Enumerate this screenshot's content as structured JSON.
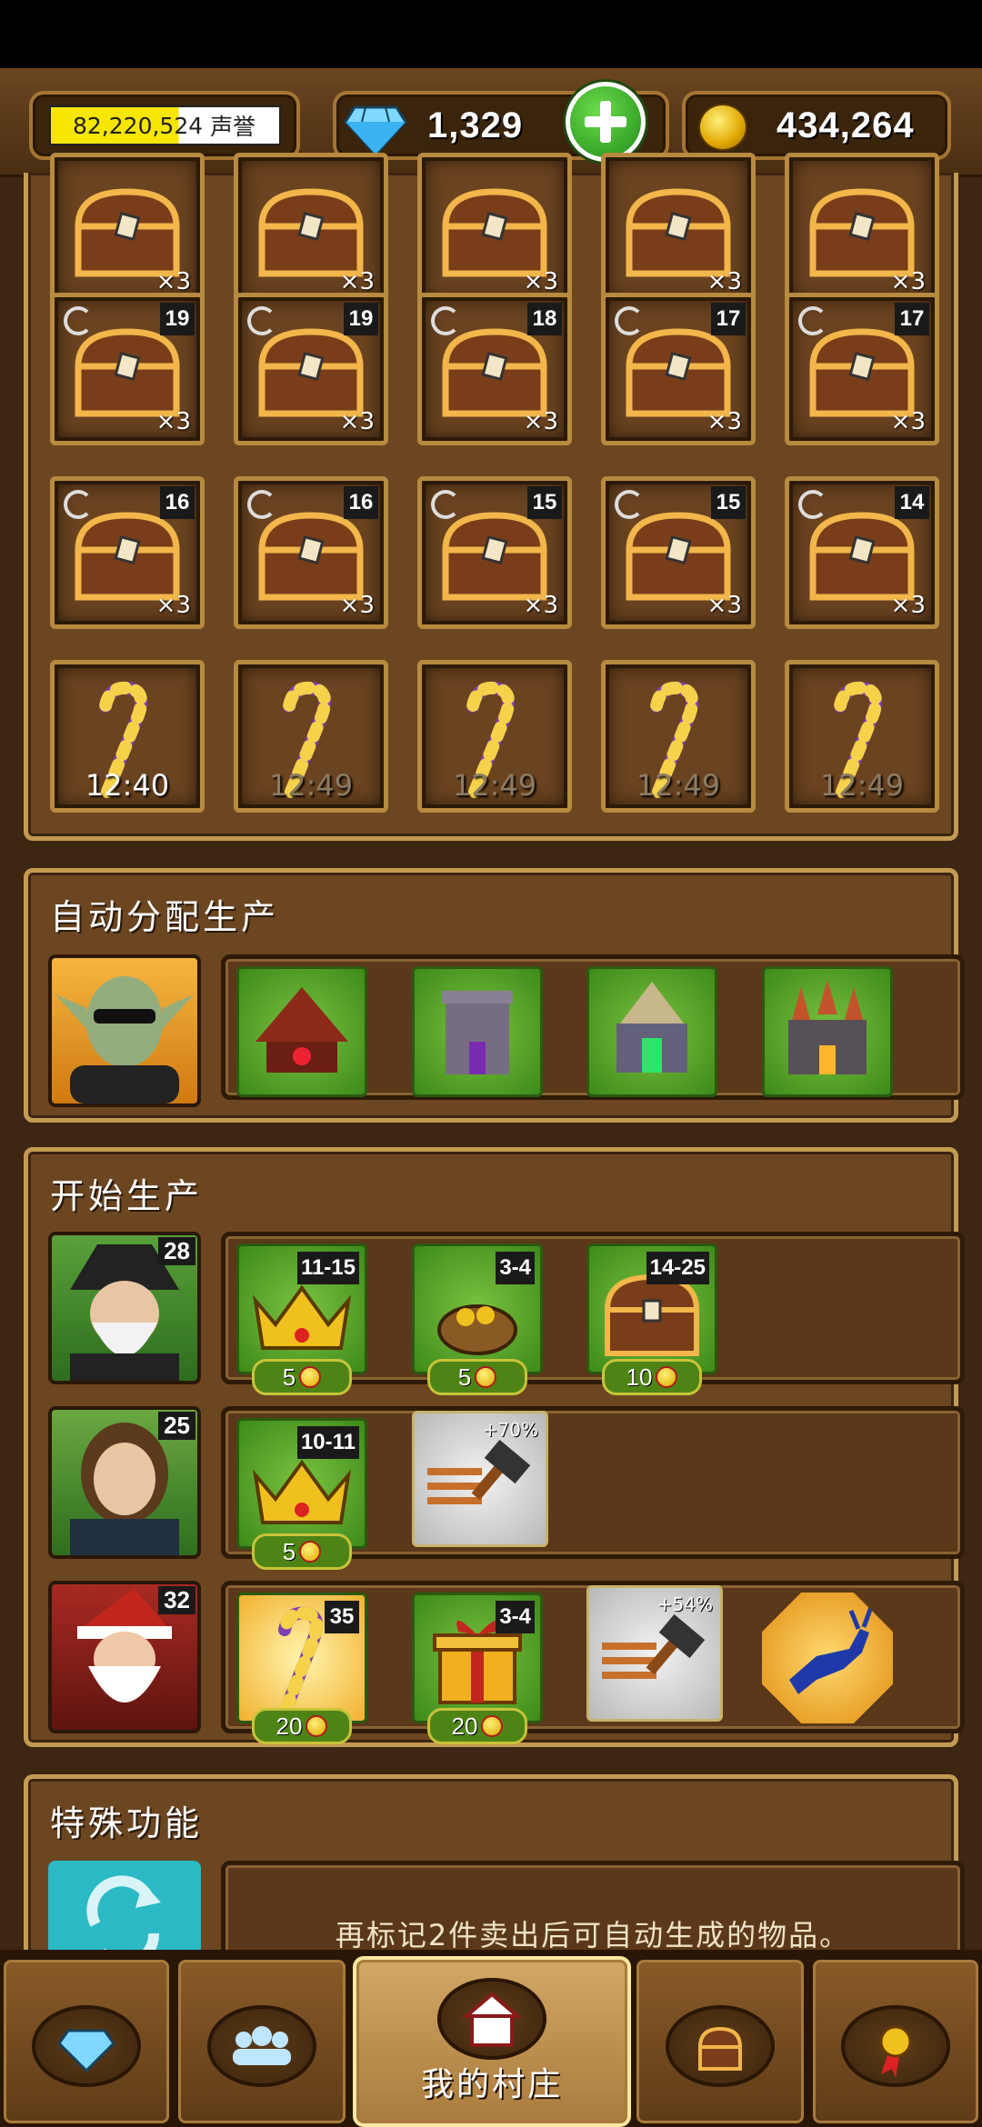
{
  "topbar": {
    "fame_value": "82,220,524",
    "fame_label": "声誉",
    "gems": "1,329",
    "gold": "434,264"
  },
  "chest_rows": [
    {
      "cells": [
        {
          "level": "",
          "count": "×3"
        },
        {
          "level": "",
          "count": "×3"
        },
        {
          "level": "",
          "count": "×3"
        },
        {
          "level": "",
          "count": "×3"
        },
        {
          "level": "",
          "count": "×3"
        }
      ]
    },
    {
      "cells": [
        {
          "level": "19",
          "count": "×3"
        },
        {
          "level": "19",
          "count": "×3"
        },
        {
          "level": "18",
          "count": "×3"
        },
        {
          "level": "17",
          "count": "×3"
        },
        {
          "level": "17",
          "count": "×3"
        }
      ]
    },
    {
      "cells": [
        {
          "level": "16",
          "count": "×3"
        },
        {
          "level": "16",
          "count": "×3"
        },
        {
          "level": "15",
          "count": "×3"
        },
        {
          "level": "15",
          "count": "×3"
        },
        {
          "level": "14",
          "count": "×3"
        }
      ]
    }
  ],
  "candy_times": [
    "12:40",
    "12:49",
    "12:49",
    "12:49",
    "12:49"
  ],
  "auto_section": {
    "title": "自动分配生产"
  },
  "production": {
    "title": "开始生产",
    "workers": [
      {
        "level": "28",
        "items": [
          {
            "label": "11-15",
            "cost": "5"
          },
          {
            "label": "3-4",
            "cost": "5"
          },
          {
            "label": "14-25",
            "cost": "10"
          }
        ]
      },
      {
        "level": "25",
        "items": [
          {
            "label": "10-11",
            "cost": "5"
          }
        ],
        "boost": "+70%"
      },
      {
        "level": "32",
        "items": [
          {
            "label": "35",
            "cost": "20"
          },
          {
            "label": "3-4",
            "cost": "20"
          }
        ],
        "boost": "+54%"
      }
    ]
  },
  "special": {
    "title": "特殊功能",
    "text": "再标记2件卖出后可自动生成的物品。"
  },
  "nav": {
    "village_label": "我的村庄"
  },
  "icons": [
    "gem-icon",
    "coin-icon",
    "chest-icon",
    "candy-cane-icon",
    "crown-icon",
    "gold-sack-icon",
    "gift-icon",
    "hammer-icon",
    "reindeer-icon",
    "refresh-icon",
    "people-icon",
    "medal-icon",
    "house-icon"
  ]
}
